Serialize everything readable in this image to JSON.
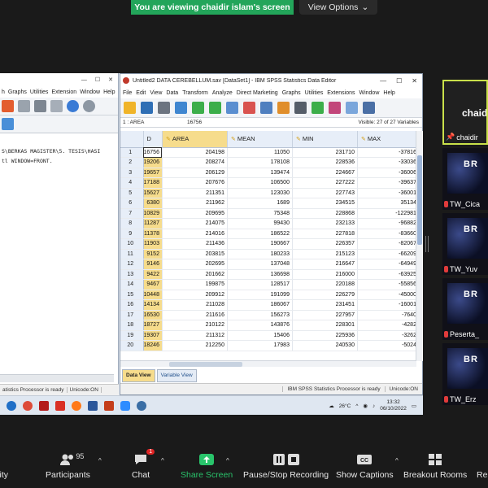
{
  "banner": {
    "text": "You are viewing chaidir islam's screen",
    "view_options": "View Options"
  },
  "left_window": {
    "menu": [
      "h",
      "Graphs",
      "Utilities",
      "Extension",
      "Window",
      "Help"
    ],
    "syntax_lines": [
      "S\\BERKAS MAGISTER\\5. TESIS\\HASI",
      "tl WINDOW=FRONT."
    ],
    "status": [
      "atistics Processor is ready",
      "Unicode:ON"
    ]
  },
  "data_editor": {
    "title": "Untitled2 DATA CEREBELLUM.sav [DataSet1] - IBM SPSS Statistics Data Editor",
    "menu": [
      "File",
      "Edit",
      "View",
      "Data",
      "Transform",
      "Analyze",
      "Direct Marketing",
      "Graphs",
      "Utilities",
      "Extensions",
      "Window",
      "Help"
    ],
    "cell_name": "1 : AREA",
    "cell_value": "16756",
    "visible": "Visible: 27 of 27 Variables",
    "columns": [
      "D",
      "AREA",
      "MEAN",
      "MIN",
      "MAX"
    ],
    "rows": [
      [
        "1",
        "16756",
        "204198",
        "11050",
        "231710",
        "-37816"
      ],
      [
        "2",
        "19206",
        "208274",
        "178108",
        "228536",
        "-33036"
      ],
      [
        "3",
        "19657",
        "206129",
        "139474",
        "224667",
        "-36006"
      ],
      [
        "4",
        "17188",
        "207676",
        "106500",
        "227222",
        "-39637"
      ],
      [
        "5",
        "15627",
        "211351",
        "123030",
        "227743",
        "-36001"
      ],
      [
        "6",
        "6380",
        "211962",
        "1689",
        "234515",
        "35134"
      ],
      [
        "7",
        "10829",
        "209695",
        "75348",
        "228868",
        "-122981"
      ],
      [
        "8",
        "11287",
        "214075",
        "99430",
        "232133",
        "-96882"
      ],
      [
        "9",
        "11378",
        "214016",
        "186522",
        "227818",
        "-83660"
      ],
      [
        "10",
        "11903",
        "211436",
        "190667",
        "226357",
        "-82067"
      ],
      [
        "11",
        "9152",
        "203815",
        "180233",
        "215123",
        "-66209"
      ],
      [
        "12",
        "9146",
        "202695",
        "137048",
        "216647",
        "-64949"
      ],
      [
        "13",
        "9422",
        "201662",
        "136698",
        "216000",
        "-63925"
      ],
      [
        "14",
        "9467",
        "199875",
        "128517",
        "220188",
        "-55856"
      ],
      [
        "15",
        "10448",
        "209912",
        "191099",
        "226279",
        "-45000"
      ],
      [
        "16",
        "14134",
        "211028",
        "186067",
        "231451",
        "-16001"
      ],
      [
        "17",
        "16530",
        "211616",
        "156273",
        "227957",
        "-7640"
      ],
      [
        "18",
        "18727",
        "210122",
        "143876",
        "228301",
        "-4282"
      ],
      [
        "19",
        "19307",
        "211312",
        "15406",
        "225936",
        "-3262"
      ],
      [
        "20",
        "18246",
        "212250",
        "17983",
        "240530",
        "-5024"
      ]
    ],
    "tabs": [
      "Data View",
      "Variable View"
    ],
    "status": [
      "IBM SPSS Statistics Processor is ready",
      "Unicode:ON"
    ]
  },
  "taskbar": {
    "temp": "26°C",
    "time": "13:32",
    "date": "06/10/2022"
  },
  "participants": {
    "active_name": "chaid",
    "active_label": "chaidir",
    "tiles": [
      {
        "brand": "BR",
        "name": "TW_Cica"
      },
      {
        "brand": "BR",
        "name": "TW_Yuv"
      },
      {
        "brand": "BR",
        "name": "Peserta_"
      },
      {
        "brand": "BR",
        "name": "TW_Erz"
      }
    ]
  },
  "zoom_toolbar": {
    "security": "rity",
    "participants": "Participants",
    "participant_count": "95",
    "chat": "Chat",
    "chat_badge": "1",
    "share": "Share Screen",
    "record": "Pause/Stop Recording",
    "captions": "Show Captions",
    "breakout": "Breakout Rooms",
    "reactions": "Re"
  }
}
